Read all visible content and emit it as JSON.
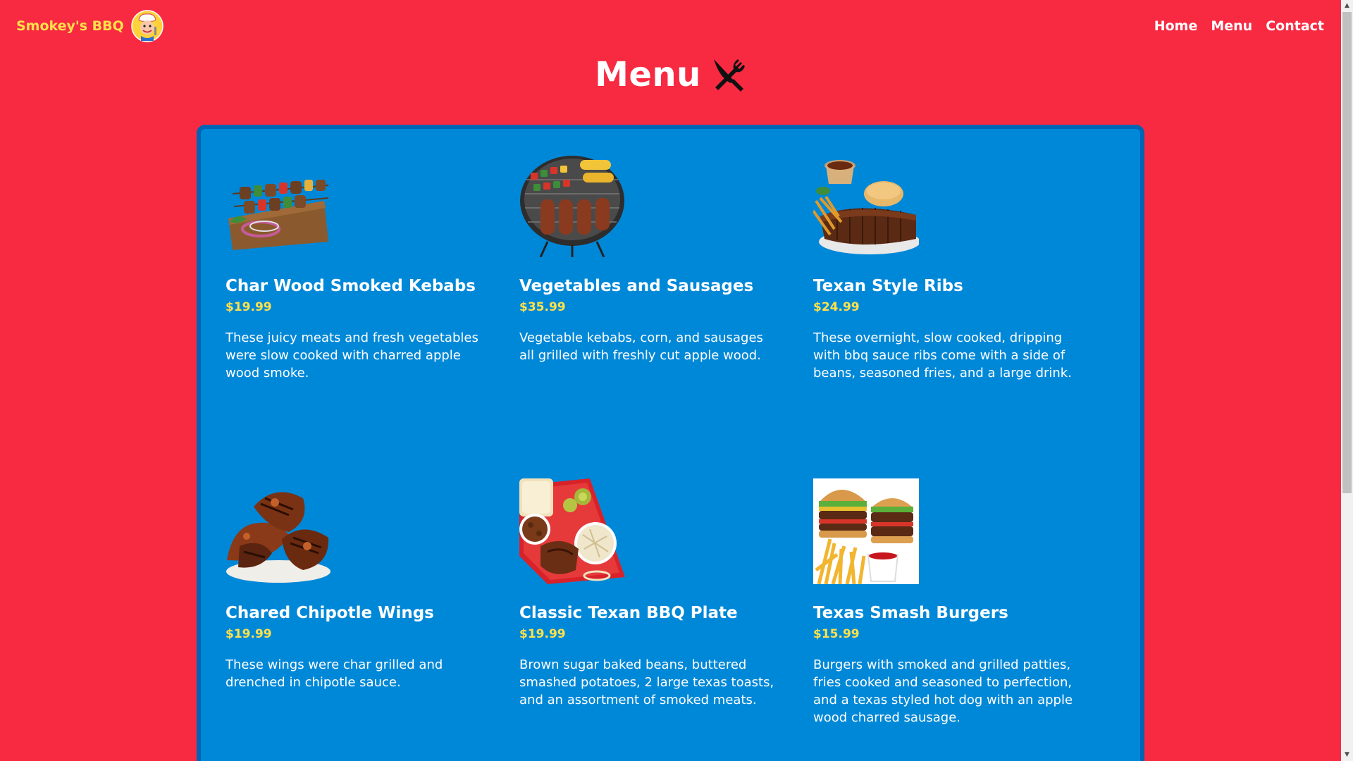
{
  "header": {
    "brand_name": "Smokey's BBQ",
    "nav": [
      "Home",
      "Menu",
      "Contact"
    ]
  },
  "page_title": "Menu",
  "colors": {
    "background": "#f72a42",
    "panel": "#0088d8",
    "panel_border": "#0064b4",
    "price": "#ffe14a",
    "brand": "#ffe14a"
  },
  "icons": {
    "logo": "chef-mascot-icon",
    "title": "fork-knife-icon"
  },
  "menu_items": [
    {
      "name": "Char Wood Smoked Kebabs",
      "price": "$19.99",
      "description": "These juicy meats and fresh vegetables were slow cooked with charred apple wood smoke.",
      "image": "kebabs-image"
    },
    {
      "name": "Vegetables and Sausages",
      "price": "$35.99",
      "description": "Vegetable kebabs, corn, and sausages all grilled with freshly cut apple wood.",
      "image": "grill-image"
    },
    {
      "name": "Texan Style Ribs",
      "price": "$24.99",
      "description": "These overnight, slow cooked, dripping with bbq sauce ribs come with a side of beans, seasoned fries, and a large drink.",
      "image": "ribs-image"
    },
    {
      "name": "Chared Chipotle Wings",
      "price": "$19.99",
      "description": "These wings were char grilled and drenched in chipotle sauce.",
      "image": "wings-image"
    },
    {
      "name": "Classic Texan BBQ Plate",
      "price": "$19.99",
      "description": "Brown sugar baked beans, buttered smashed potatoes, 2 large texas toasts, and an assortment of smoked meats.",
      "image": "bbq-plate-image"
    },
    {
      "name": "Texas Smash Burgers",
      "price": "$15.99",
      "description": "Burgers with smoked and grilled patties, fries cooked and seasoned to perfection, and a texas styled hot dog with an apple wood charred sausage.",
      "image": "burgers-image"
    }
  ]
}
